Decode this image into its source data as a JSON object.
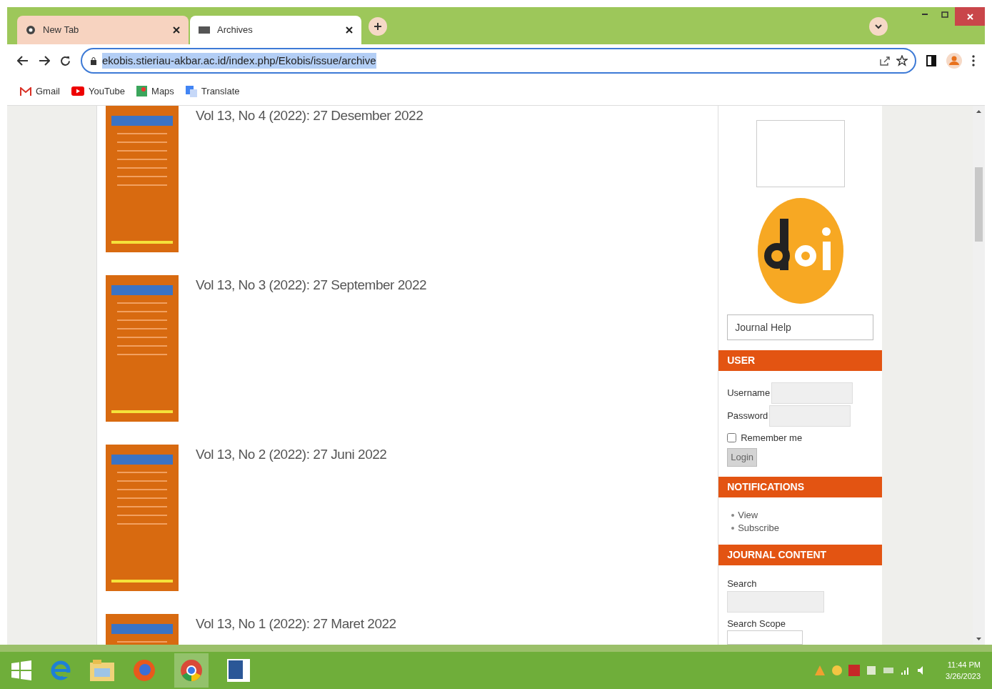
{
  "tabs": [
    {
      "title": "New Tab",
      "selected": false
    },
    {
      "title": "Archives",
      "selected": true
    }
  ],
  "address_bar": {
    "url": "ekobis.stieriau-akbar.ac.id/index.php/Ekobis/issue/archive",
    "selected_text": true
  },
  "bookmarks": [
    {
      "label": "Gmail"
    },
    {
      "label": "YouTube"
    },
    {
      "label": "Maps"
    },
    {
      "label": "Translate"
    }
  ],
  "issues": [
    {
      "title": "Vol 13, No 4 (2022): 27 Desember 2022"
    },
    {
      "title": "Vol 13, No 3 (2022): 27 September 2022"
    },
    {
      "title": "Vol 13, No 2 (2022): 27 Juni 2022"
    },
    {
      "title": "Vol 13, No 1 (2022): 27 Maret 2022"
    }
  ],
  "sidebar": {
    "journal_help": "Journal Help",
    "user": {
      "heading": "USER",
      "username_label": "Username",
      "password_label": "Password",
      "remember_label": "Remember me",
      "remember_checked": false,
      "login_button": "Login"
    },
    "notifications": {
      "heading": "NOTIFICATIONS",
      "links": [
        "View",
        "Subscribe"
      ]
    },
    "journal_content": {
      "heading": "JOURNAL CONTENT",
      "search_label": "Search",
      "scope_label": "Search Scope"
    }
  },
  "taskbar": {
    "time": "11:44 PM",
    "date": "3/26/2023"
  }
}
